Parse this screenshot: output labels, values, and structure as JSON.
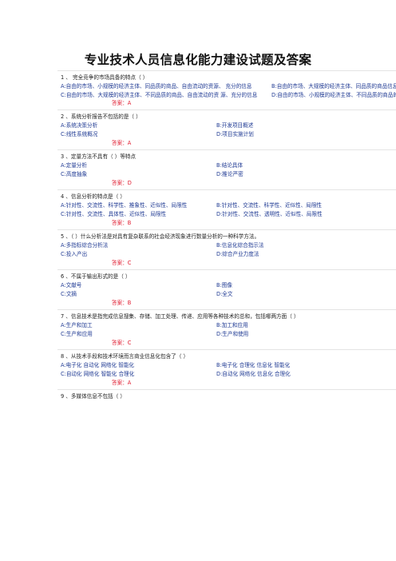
{
  "title": "专业技术人员信息化能力建设试题及答案",
  "questions": [
    {
      "stem": "1 、 完全竞争的市场具备的特点（ ）",
      "a": "A:自由的市场、小规模的经济主体、同品质的商品、自由流动的资源、 充分的信息",
      "b": "B:自由的市场、大规模的经济主体、同品质的商品信息",
      "c": "C:自由的市场、大规模的经济主体、不同品质的商品、自由流动的资 源、充分的信息",
      "d": "D:自由的市场、小规模的经济主体、不同品质的商品的信息",
      "answer": "答案：A"
    },
    {
      "stem": "2 、系统分析报告不包括的是（ ）",
      "a": "A:系统决策分析",
      "b": "B:开发项目概述",
      "c": "C:线性系统概况",
      "d": "D:项目实施计划",
      "answer": "答案：A"
    },
    {
      "stem": "3 、定量方法不具有（ ）等特点",
      "a": "A:定量分析",
      "b": "B:结论具体",
      "c": "C:高度抽象",
      "d": "D:推论严密",
      "answer": "答案：D"
    },
    {
      "stem": "4 、信息分析的特点是（ ）",
      "a": "A:针对性、交流性、科学性、推象性、近似性、局限性",
      "b": "B:针对性、交流性、科学性、近似性、局限性",
      "c": "C:针对性、交流性、具体性、近似性、局限性",
      "d": "D:针对性、交流性、透明性、近似性、局限性",
      "answer": "答案：B"
    },
    {
      "stem": "5 、（ ）什么分析法是对具有复杂联系的社会经济现象进行数量分析的一种科学方法。",
      "a": "A:多指标综合分析法",
      "b": "B:信息化综合指示法",
      "c": "C:投入产出",
      "d": "D:综合产业力度法",
      "answer": "答案：C"
    },
    {
      "stem": "6 、不属于输出形式的是（ ）",
      "a": "A:文献号",
      "b": "B:图像",
      "c": "C:文摘",
      "d": "D:全文",
      "answer": "答案：B"
    },
    {
      "stem": "7 、信息技术是指完成信息搜集、存储、加工处理、传递、应用等各种技术的总和，包括哪两方面（ ）",
      "a": "A:生产和加工",
      "b": "B:加工和应用",
      "c": "C:生产和应用",
      "d": "D:生产和使用",
      "answer": "答案：C"
    },
    {
      "stem": "8 、从技术手段和技术环境而言商业信息化包含了（ ）",
      "a": "A:电子化 自动化 网络化 智能化",
      "b": "B:电子化 合理化 信息化 智能化",
      "c": "C:自动化 网络化 智能化 合理化",
      "d": "D:自动化 网络化 信息化 合理化",
      "answer": "答案：A"
    },
    {
      "stem": "9 、多媒体信息不包括（ ）"
    }
  ]
}
